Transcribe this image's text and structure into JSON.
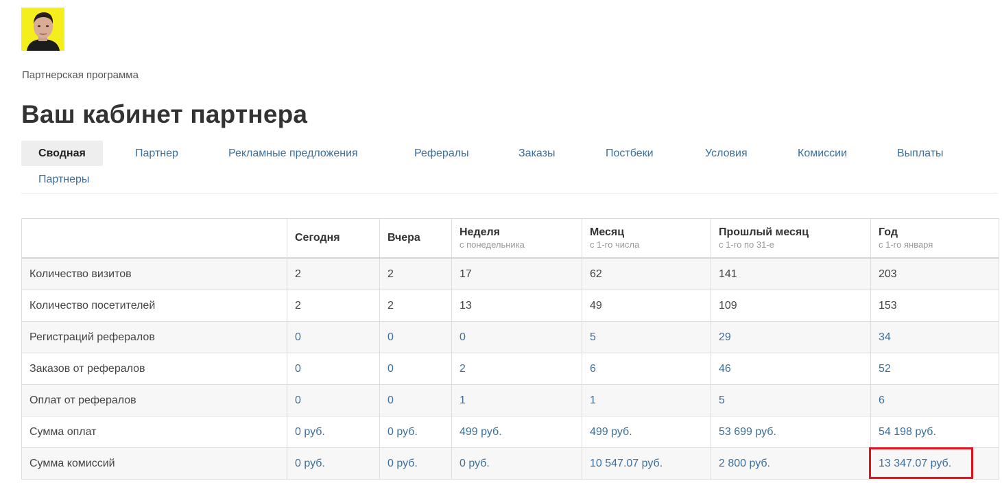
{
  "avatar": {
    "icon": "user-photo",
    "background": "#f4ef1c"
  },
  "breadcrumb": "Партнерская программа",
  "page_title": "Ваш кабинет партнера",
  "tabs": [
    {
      "label": "Сводная",
      "active": true
    },
    {
      "label": "Партнер"
    },
    {
      "label": "Рекламные предложения"
    },
    {
      "label": "Рефералы"
    },
    {
      "label": "Заказы"
    },
    {
      "label": "Постбеки"
    },
    {
      "label": "Условия"
    },
    {
      "label": "Комиссии"
    },
    {
      "label": "Выплаты"
    },
    {
      "label": "Партнеры"
    }
  ],
  "table": {
    "columns": [
      {
        "title": "",
        "subtitle": ""
      },
      {
        "title": "Сегодня",
        "subtitle": ""
      },
      {
        "title": "Вчера",
        "subtitle": ""
      },
      {
        "title": "Неделя",
        "subtitle": "с понедельника"
      },
      {
        "title": "Месяц",
        "subtitle": "с 1-го числа"
      },
      {
        "title": "Прошлый месяц",
        "subtitle": "с 1-го по 31-е"
      },
      {
        "title": "Год",
        "subtitle": "с 1-го января"
      }
    ],
    "rows": [
      {
        "label": "Количество визитов",
        "values": [
          "2",
          "2",
          "17",
          "62",
          "141",
          "203"
        ],
        "link": false
      },
      {
        "label": "Количество посетителей",
        "values": [
          "2",
          "2",
          "13",
          "49",
          "109",
          "153"
        ],
        "link": false
      },
      {
        "label": "Регистраций рефералов",
        "values": [
          "0",
          "0",
          "0",
          "5",
          "29",
          "34"
        ],
        "link": true
      },
      {
        "label": "Заказов от рефералов",
        "values": [
          "0",
          "0",
          "2",
          "6",
          "46",
          "52"
        ],
        "link": true
      },
      {
        "label": "Оплат от рефералов",
        "values": [
          "0",
          "0",
          "1",
          "1",
          "5",
          "6"
        ],
        "link": true
      },
      {
        "label": "Сумма оплат",
        "values": [
          "0 руб.",
          "0 руб.",
          "499 руб.",
          "499 руб.",
          "53 699 руб.",
          "54 198 руб."
        ],
        "link": true
      },
      {
        "label": "Сумма комиссий",
        "values": [
          "0 руб.",
          "0 руб.",
          "0 руб.",
          "10 547.07 руб.",
          "2 800 руб.",
          "13 347.07 руб."
        ],
        "link": true
      }
    ]
  },
  "colors": {
    "link": "#3a6f9e",
    "highlight": "#e3111b",
    "active_tab_bg": "#eeeeee"
  }
}
